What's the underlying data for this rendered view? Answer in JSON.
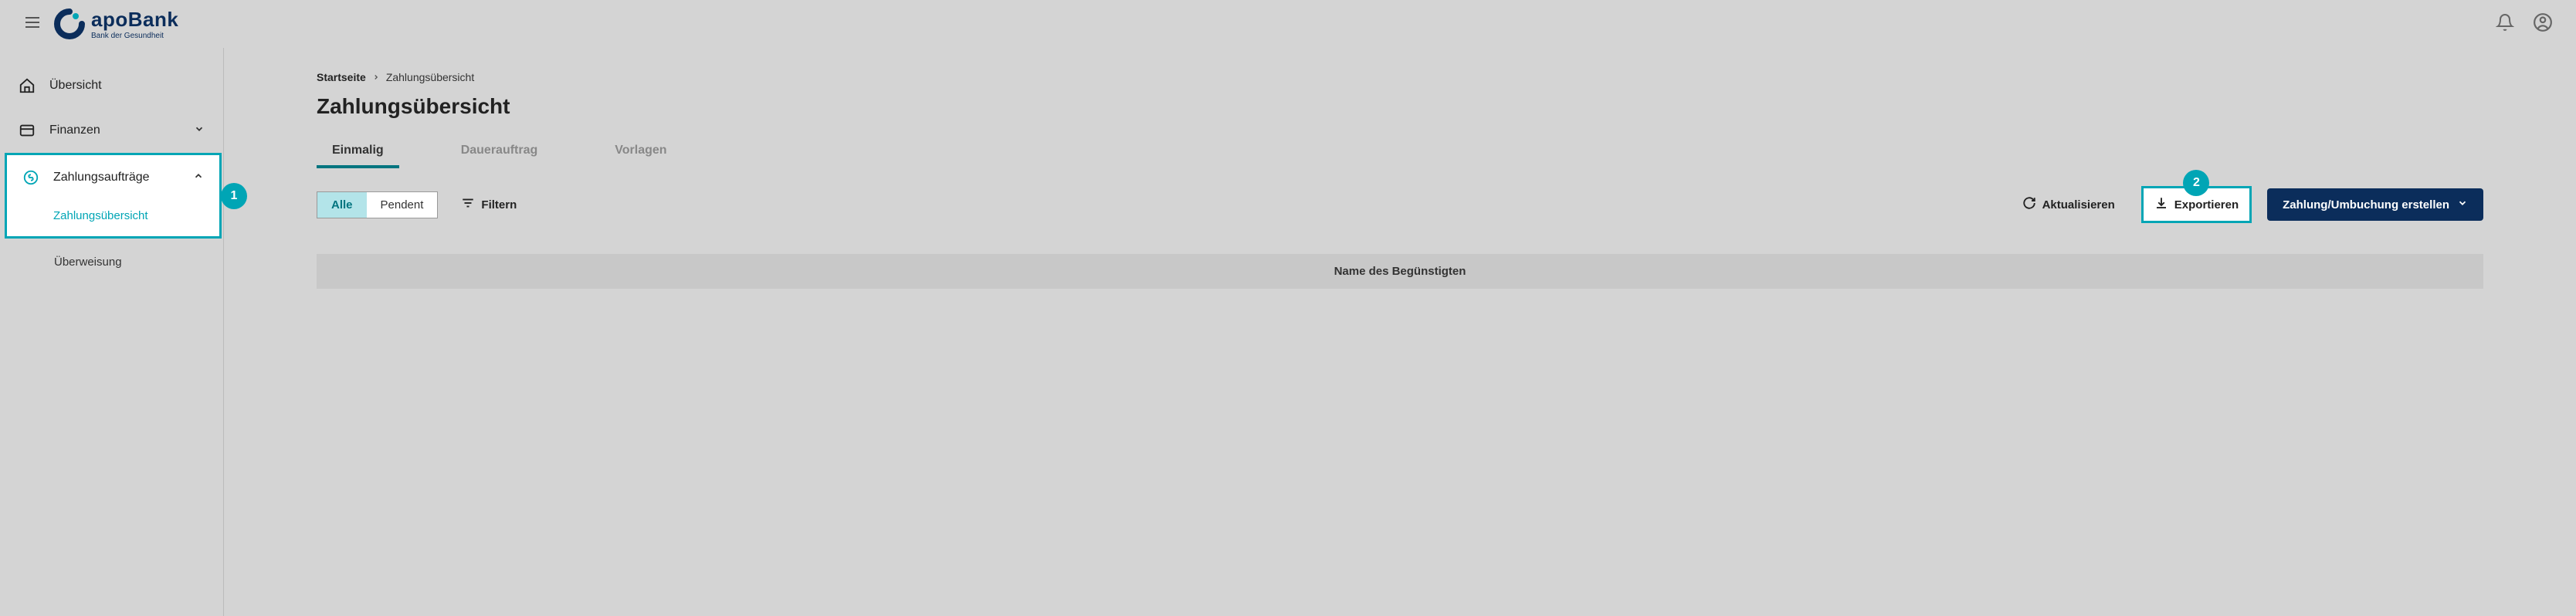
{
  "header": {
    "logo_name": "apoBank",
    "logo_tag": "Bank der Gesundheit"
  },
  "sidebar": {
    "items": [
      {
        "label": "Übersicht"
      },
      {
        "label": "Finanzen"
      },
      {
        "label": "Zahlungsaufträge"
      },
      {
        "label": "Zahlungsübersicht"
      },
      {
        "label": "Überweisung"
      }
    ]
  },
  "badges": {
    "one": "1",
    "two": "2"
  },
  "breadcrumb": {
    "home": "Startseite",
    "current": "Zahlungsübersicht"
  },
  "page_title": "Zahlungsübersicht",
  "tabs": [
    {
      "label": "Einmalig"
    },
    {
      "label": "Dauerauftrag"
    },
    {
      "label": "Vorlagen"
    }
  ],
  "segmented": {
    "all": "Alle",
    "pending": "Pendent"
  },
  "toolbar": {
    "filter": "Filtern",
    "refresh": "Aktualisieren",
    "export": "Exportieren",
    "create": "Zahlung/Umbuchung erstellen"
  },
  "table": {
    "col_beneficiary": "Name des Begünstigten"
  }
}
